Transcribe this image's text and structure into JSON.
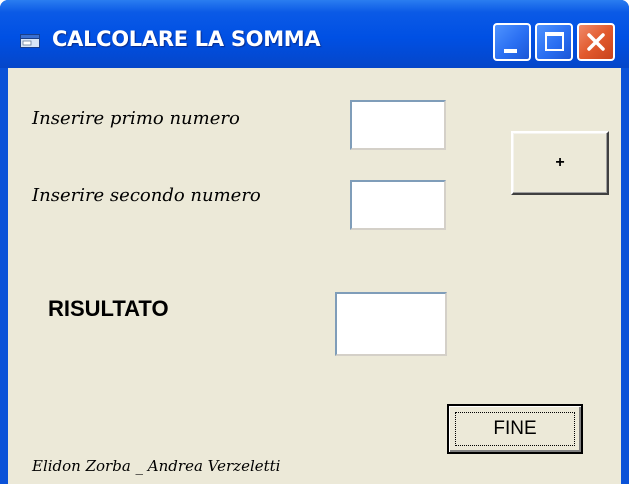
{
  "window": {
    "title": "CALCOLARE LA SOMMA",
    "controls": {
      "minimize_icon": "minimize-icon",
      "maximize_icon": "maximize-icon",
      "close_icon": "close-icon"
    },
    "titlebar_color": "#0054E3",
    "close_color": "#E25A2E"
  },
  "form": {
    "primo_label": "Inserire primo numero",
    "primo_value": "",
    "secondo_label": "Inserire secondo numero",
    "secondo_value": "",
    "risultato_label": "RISULTATO",
    "risultato_value": "",
    "add_button_label": "+",
    "fine_button_label": "FINE",
    "credits": "Elidon Zorba _ Andrea Verzeletti",
    "background": "#ECE9D8"
  }
}
